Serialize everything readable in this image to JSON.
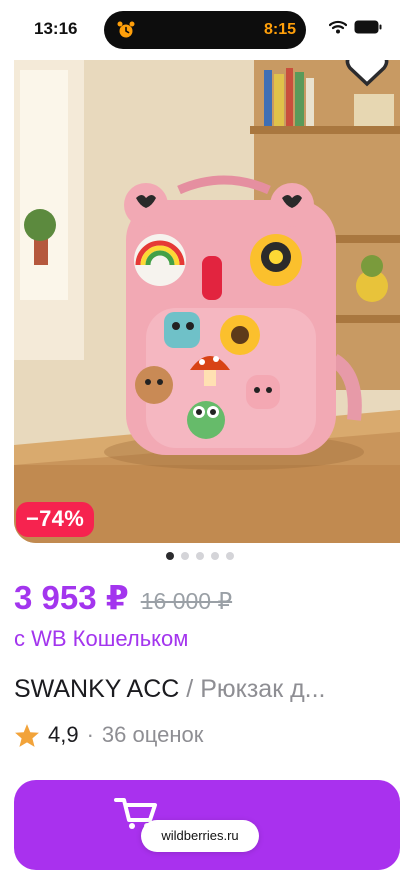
{
  "status_bar": {
    "time": "13:16",
    "alarm_time": "8:15"
  },
  "product": {
    "discount": "−74%",
    "prices": {
      "current": "3 953 ₽",
      "old": "16 000 ₽"
    },
    "wallet_note": "с WB Кошельком",
    "brand": "SWANKY ACC",
    "separator": "/",
    "name": "Рюкзак д...",
    "rating": "4,9",
    "rating_separator": "·",
    "reviews": "36 оценок"
  },
  "gallery": {
    "dots": 5,
    "active_index": 0
  },
  "cart": {
    "label": ""
  },
  "browser": {
    "url": "wildberries.ru"
  },
  "colors": {
    "accent": "#a335ee",
    "badge": "#f6234f",
    "star": "#f2a33a"
  },
  "icons": [
    "alarm-icon",
    "wifi-icon",
    "battery-icon",
    "favorite-icon",
    "star-icon",
    "cart-icon"
  ]
}
